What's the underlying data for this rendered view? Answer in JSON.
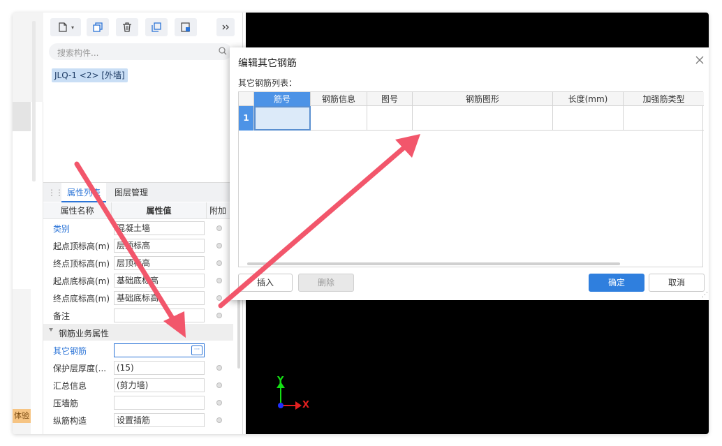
{
  "badge": {
    "experience": "体验"
  },
  "toolbar": {
    "buttons": [
      {
        "icon": "new-component-icon"
      },
      {
        "icon": "copy-icon"
      },
      {
        "icon": "delete-icon"
      },
      {
        "icon": "layer-copy-icon"
      },
      {
        "icon": "extract-icon"
      },
      {
        "icon": "expand-icon"
      }
    ]
  },
  "search": {
    "placeholder": "搜索构件..."
  },
  "component_list": {
    "items": [
      "JLQ-1 <2> [外墙]"
    ]
  },
  "property_tabs": {
    "active": "属性列表",
    "other": "图层管理"
  },
  "property_table": {
    "headers": {
      "name": "属性名称",
      "value": "属性值",
      "extra": "附加"
    },
    "rows": [
      {
        "name": "类别",
        "value": "混凝土墙"
      },
      {
        "name": "起点顶标高(m)",
        "value": "层顶标高"
      },
      {
        "name": "终点顶标高(m)",
        "value": "层顶标高"
      },
      {
        "name": "起点底标高(m)",
        "value": "基础底标高"
      },
      {
        "name": "终点底标高(m)",
        "value": "基础底标高"
      },
      {
        "name": "备注",
        "value": ""
      }
    ],
    "group": "钢筋业务属性",
    "group_rows": [
      {
        "name": "其它钢筋",
        "value": "",
        "ellipsis": "···"
      },
      {
        "name": "保护层厚度(...",
        "value": "(15)"
      },
      {
        "name": "汇总信息",
        "value": "(剪力墙)"
      },
      {
        "name": "压墙筋",
        "value": ""
      },
      {
        "name": "纵筋构造",
        "value": "设置插筋"
      }
    ]
  },
  "dialog": {
    "title": "编辑其它钢筋",
    "list_label": "其它钢筋列表：",
    "columns": [
      "筋号",
      "钢筋信息",
      "图号",
      "钢筋图形",
      "长度(mm)",
      "加强筋类型"
    ],
    "rows": [
      {
        "index": "1",
        "cells": [
          "",
          "",
          "",
          "",
          "",
          ""
        ]
      }
    ],
    "buttons": {
      "insert": "插入",
      "delete": "删除",
      "ok": "确定",
      "cancel": "取消"
    }
  },
  "axes": {
    "x_label": "X",
    "y_label": "Y"
  },
  "colors": {
    "accent": "#2f7fde",
    "arrow": "#f2566b",
    "axis_x": "#e32020",
    "axis_y": "#14e014"
  }
}
